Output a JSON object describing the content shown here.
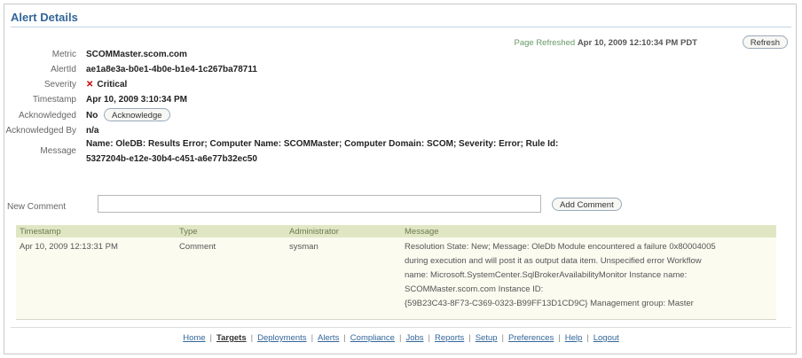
{
  "page": {
    "title": "Alert Details",
    "refreshed_prefix": "Page Refreshed",
    "refreshed_date": "Apr 10, 2009 12:10:34 PM PDT",
    "refresh_label": "Refresh"
  },
  "details": {
    "metric_label": "Metric",
    "metric_value": "SCOMMaster.scom.com",
    "alertid_label": "AlertId",
    "alertid_value": "ae1a8e3a-b0e1-4b0e-b1e4-1c267ba78711",
    "severity_label": "Severity",
    "severity_value": "Critical",
    "timestamp_label": "Timestamp",
    "timestamp_value": "Apr 10, 2009 3:10:34 PM",
    "acknowledged_label": "Acknowledged",
    "acknowledged_value": "No",
    "acknowledge_button": "Acknowledge",
    "ackby_label": "Acknowledged By",
    "ackby_value": "n/a",
    "message_label": "Message",
    "message_line1": "Name: OleDB: Results Error; Computer Name: SCOMMaster; Computer Domain: SCOM; Severity: Error; Rule Id:",
    "message_line2": "5327204b-e12e-30b4-c451-a6e77b32ec50"
  },
  "comment": {
    "label": "New Comment",
    "value": "",
    "add_button": "Add Comment"
  },
  "table": {
    "headers": [
      "Timestamp",
      "Type",
      "Administrator",
      "Message"
    ],
    "rows": [
      {
        "timestamp": "Apr 10, 2009 12:13:31 PM",
        "type": "Comment",
        "administrator": "sysman",
        "message_lines": [
          "Resolution State: New; Message: OleDb Module encountered a failure 0x80004005",
          "during execution and will post it as output data item. Unspecified error Workflow",
          "name: Microsoft.SystemCenter.SqlBrokerAvailabilityMonitor Instance name:",
          "SCOMMaster.scom.com Instance ID:",
          "{59B23C43-8F73-C369-0323-B99FF13D1CD9C} Management group: Master"
        ]
      }
    ]
  },
  "footer": {
    "links": [
      "Home",
      "Targets",
      "Deployments",
      "Alerts",
      "Compliance",
      "Jobs",
      "Reports",
      "Setup",
      "Preferences",
      "Help",
      "Logout"
    ],
    "active": "Targets"
  },
  "colors": {
    "title": "#336699",
    "header_bg": "#e0e6c4",
    "severity": "#cc0000"
  }
}
